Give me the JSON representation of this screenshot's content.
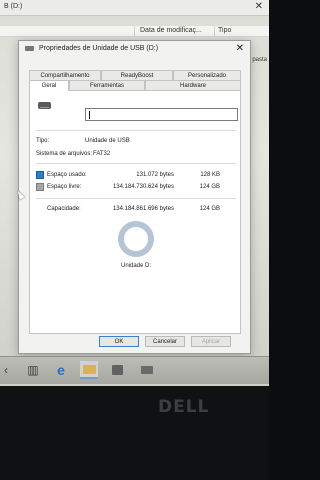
{
  "explorer": {
    "title": "B (D:)",
    "columns": {
      "name_tail": "",
      "date": "Data de modificaç...",
      "type": "Tipo"
    },
    "side_text": "pasta"
  },
  "dialog": {
    "title": "Propriedades de Unidade de USB (D:)",
    "close": "✕",
    "tabs_row1": [
      "Compartilhamento",
      "ReadyBoost",
      "Personalizado"
    ],
    "tabs_row2": [
      "Geral",
      "Ferramentas",
      "Hardware"
    ],
    "selected_tab": "Geral",
    "name_value": "",
    "type_label": "Tipo:",
    "type_value": "Unidade de USB",
    "fs_label": "Sistema de arquivos:",
    "fs_value": "FAT32",
    "used_label": "Espaço usado:",
    "used_bytes": "131.072 bytes",
    "used_short": "128 KB",
    "free_label": "Espaço livre:",
    "free_bytes": "134.184.730.624 bytes",
    "free_short": "124 GB",
    "cap_label": "Capacidade:",
    "cap_bytes": "134.184.861.696 bytes",
    "cap_short": "124 GB",
    "drive_label": "Unidade D:",
    "used_fraction": 1e-06,
    "used_color": "#2c80c2",
    "free_color": "#a7a7a7",
    "buttons": {
      "ok": "OK",
      "cancel": "Cancelar",
      "apply": "Aplicar"
    }
  },
  "taskbar": {
    "icons": [
      "back-arrow-icon",
      "task-view-icon",
      "edge-icon",
      "file-explorer-icon",
      "store-icon",
      "usb-drive-icon"
    ]
  },
  "monitor": {
    "brand": "DELL"
  }
}
